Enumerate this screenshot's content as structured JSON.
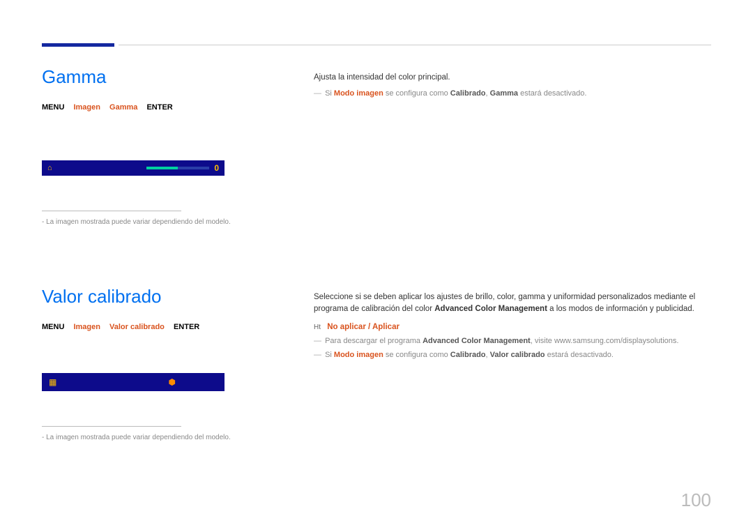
{
  "page_number": "100",
  "gamma": {
    "title": "Gamma",
    "bc_menu": "MENU",
    "bc_a": "Imagen",
    "bc_b": "Gamma",
    "bc_enter": "ENTER",
    "osd_value": "0",
    "footnote": "La imagen mostrada puede variar dependiendo del modelo.",
    "desc": "Ajusta la intensidad del color principal.",
    "note_pre": "Si ",
    "note_hl1": "Modo imagen",
    "note_mid1": " se configura como ",
    "note_bold1": "Calibrado",
    "note_mid2": ", ",
    "note_bold2": "Gamma",
    "note_tail": " estará desactivado."
  },
  "valor": {
    "title": "Valor calibrado",
    "bc_menu": "MENU",
    "bc_a": "Imagen",
    "bc_b": "Valor calibrado",
    "bc_enter": "ENTER",
    "footnote": "La imagen mostrada puede variar dependiendo del modelo.",
    "desc_pre": "Seleccione si se deben aplicar los ajustes de brillo, color, gamma y uniformidad personalizados mediante el programa de calibración del color ",
    "desc_bold": "Advanced Color Management",
    "desc_post": " a los modos de información y publicidad.",
    "bullet_sym": "Ht",
    "bullet_opts": "No aplicar / Aplicar",
    "sub1_pre": "Para descargar el programa ",
    "sub1_bold": "Advanced Color Management",
    "sub1_post": ", visite www.samsung.com/displaysolutions.",
    "sub2_pre": "Si ",
    "sub2_hl": "Modo imagen",
    "sub2_mid1": " se configura como ",
    "sub2_bold1": "Calibrado",
    "sub2_mid2": ", ",
    "sub2_bold2": "Valor calibrado",
    "sub2_tail": " estará desactivado."
  }
}
